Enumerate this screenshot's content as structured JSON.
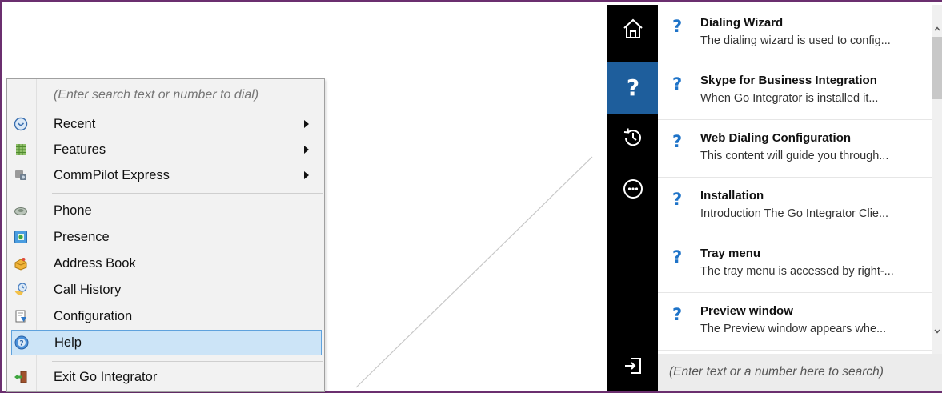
{
  "context_menu": {
    "search_placeholder": "(Enter search text or number to dial)",
    "items": [
      {
        "label": "Recent",
        "icon": "clock-icon",
        "submenu": true
      },
      {
        "label": "Features",
        "icon": "features-grid-icon",
        "submenu": true
      },
      {
        "label": "CommPilot Express",
        "icon": "commpilot-icon",
        "submenu": true
      },
      {
        "label": "Phone",
        "icon": "phone-icon",
        "submenu": false
      },
      {
        "label": "Presence",
        "icon": "presence-icon",
        "submenu": false
      },
      {
        "label": "Address Book",
        "icon": "address-book-icon",
        "submenu": false
      },
      {
        "label": "Call History",
        "icon": "call-history-icon",
        "submenu": false
      },
      {
        "label": "Configuration",
        "icon": "configuration-icon",
        "submenu": false
      },
      {
        "label": "Help",
        "icon": "help-icon",
        "submenu": false,
        "selected": true
      },
      {
        "label": "Exit Go Integrator",
        "icon": "exit-icon",
        "submenu": false
      }
    ]
  },
  "help_pane": {
    "sidebar": [
      {
        "icon": "home-icon",
        "active": false
      },
      {
        "icon": "help-icon",
        "active": true
      },
      {
        "icon": "history-icon",
        "active": false
      },
      {
        "icon": "more-icon",
        "active": false
      }
    ],
    "exit_icon": "sign-out-icon",
    "articles": [
      {
        "title": "Dialing Wizard",
        "summary": "The dialing wizard is used to config..."
      },
      {
        "title": "Skype for Business Integration",
        "summary": "When Go Integrator is installed it..."
      },
      {
        "title": "Web Dialing Configuration",
        "summary": "This content will guide you through..."
      },
      {
        "title": "Installation",
        "summary": "Introduction The Go Integrator Clie..."
      },
      {
        "title": "Tray menu",
        "summary": "The tray menu is accessed by right-..."
      },
      {
        "title": "Preview window",
        "summary": "The Preview window appears whe..."
      }
    ],
    "search_placeholder": "(Enter text or a number here to search)"
  },
  "colors": {
    "frame": "#6b2f6f",
    "sidebar_bg": "#000000",
    "sidebar_active": "#1e5e9c",
    "question_mark": "#1e73c8",
    "menu_selected_bg": "#cce4f7",
    "menu_selected_border": "#5fa2dd"
  }
}
